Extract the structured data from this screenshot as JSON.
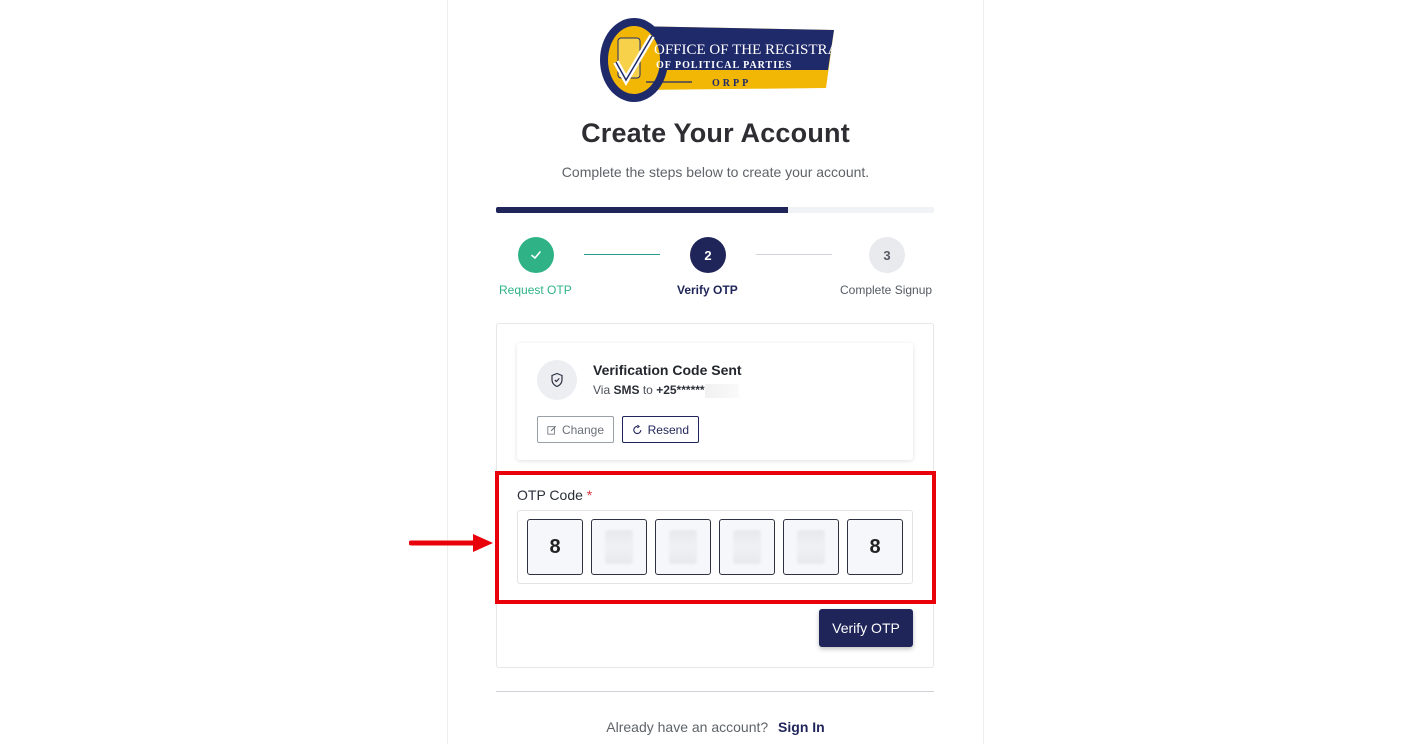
{
  "logo": {
    "line1": "OFFICE OF THE REGISTRAR",
    "line2": "OF POLITICAL PARTIES",
    "line3": "ORPP"
  },
  "header": {
    "title": "Create Your Account",
    "subtitle": "Complete the steps below to create your account."
  },
  "progress": {
    "fraction": 0.666
  },
  "steps": [
    {
      "number": "1",
      "label": "Request OTP",
      "status": "completed"
    },
    {
      "number": "2",
      "label": "Verify OTP",
      "status": "active"
    },
    {
      "number": "3",
      "label": "Complete Signup",
      "status": "pending"
    }
  ],
  "verification": {
    "title": "Verification Code Sent",
    "via_prefix": "Via",
    "channel": "SMS",
    "to_word": "to",
    "phone_masked": "+25******",
    "change_label": "Change",
    "resend_label": "Resend"
  },
  "otp": {
    "label": "OTP Code",
    "required_mark": "*",
    "digits": [
      "8",
      "",
      "",
      "",
      "",
      "8"
    ]
  },
  "actions": {
    "verify_label": "Verify OTP"
  },
  "footer": {
    "prompt": "Already have an account?",
    "signin_label": "Sign In"
  },
  "colors": {
    "primary": "#1f2559",
    "success": "#2fb386",
    "highlight": "#e8000b",
    "logo_gold": "#f2b705"
  }
}
